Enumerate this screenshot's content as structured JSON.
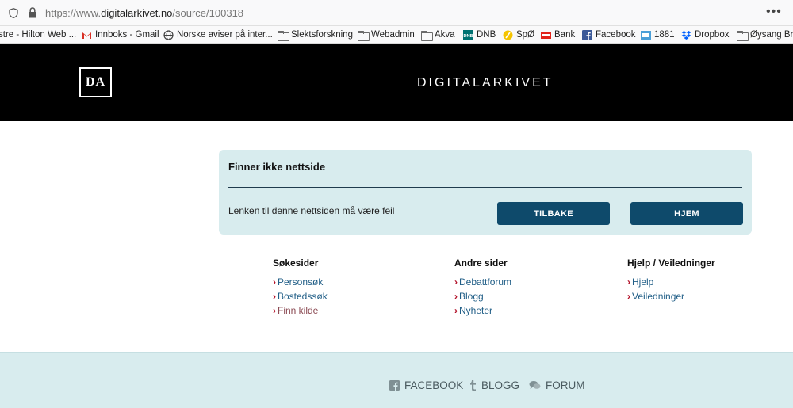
{
  "browser": {
    "url_scheme": "https://www.",
    "url_host": "digitalarkivet.no",
    "url_path": "/source/100318",
    "menu_label": "•••",
    "bookmarks": [
      {
        "label": "stre - Hilton Web ...",
        "icon": "none"
      },
      {
        "label": "Innboks - Gmail",
        "icon": "gmail-icon"
      },
      {
        "label": "Norske aviser på inter...",
        "icon": "globe-icon"
      },
      {
        "label": "Slektsforskning",
        "icon": "folder-icon"
      },
      {
        "label": "Webadmin",
        "icon": "folder-icon"
      },
      {
        "label": "Akva",
        "icon": "folder-icon"
      },
      {
        "label": "DNB",
        "icon": "dnb-icon"
      },
      {
        "label": "SpØ",
        "icon": "spo-icon"
      },
      {
        "label": "Bank",
        "icon": "bank-icon"
      },
      {
        "label": "Facebook",
        "icon": "facebook-icon"
      },
      {
        "label": "1881",
        "icon": "1881-icon"
      },
      {
        "label": "Dropbox",
        "icon": "dropbox-icon"
      },
      {
        "label": "Øysang Bry",
        "icon": "folder-icon"
      }
    ]
  },
  "header": {
    "logo_text": "DA",
    "brand": "DIGITALARKIVET"
  },
  "error_panel": {
    "title": "Finner ikke nettside",
    "message": "Lenken til denne nettsiden må være feil",
    "back_label": "TILBAKE",
    "home_label": "HJEM"
  },
  "columns": [
    {
      "heading": "Søkesider",
      "links": [
        "Personsøk",
        "Bostedssøk",
        "Finn kilde"
      ]
    },
    {
      "heading": "Andre sider",
      "links": [
        "Debattforum",
        "Blogg",
        "Nyheter"
      ]
    },
    {
      "heading": "Hjelp / Veiledninger",
      "links": [
        "Hjelp",
        "Veiledninger"
      ]
    }
  ],
  "footer": {
    "facebook": "FACEBOOK",
    "blogg": "BLOGG",
    "forum": "FORUM"
  },
  "colors": {
    "header_bg": "#000000",
    "panel_bg": "#d8ecee",
    "button_bg": "#0e4a6b",
    "link": "#1f5d86",
    "chevron": "#b3122a"
  }
}
